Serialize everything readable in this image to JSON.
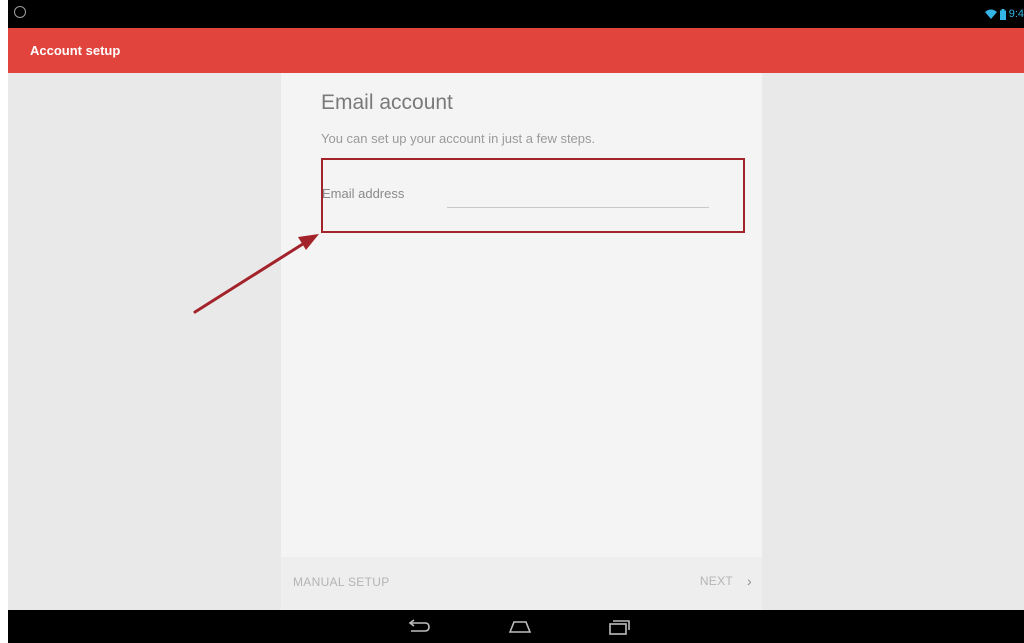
{
  "status_bar": {
    "time": "9:4",
    "icons": [
      "settings-circle-icon",
      "wifi-icon",
      "battery-icon"
    ],
    "accent": "#33b5e5"
  },
  "app_bar": {
    "title": "Account setup",
    "color": "#e0443c"
  },
  "setup_card": {
    "title": "Email account",
    "subtitle": "You can set up your account in just a few steps.",
    "email_field": {
      "label": "Email address",
      "value": ""
    },
    "footer": {
      "manual_setup_label": "MANUAL SETUP",
      "next_label": "NEXT",
      "next_icon": "chevron-right-icon"
    }
  },
  "annotation": {
    "color": "#a3232b",
    "shapes": [
      "highlight-box",
      "arrow"
    ]
  },
  "nav_bar": {
    "buttons": [
      "back-icon",
      "home-icon",
      "recents-icon"
    ]
  }
}
